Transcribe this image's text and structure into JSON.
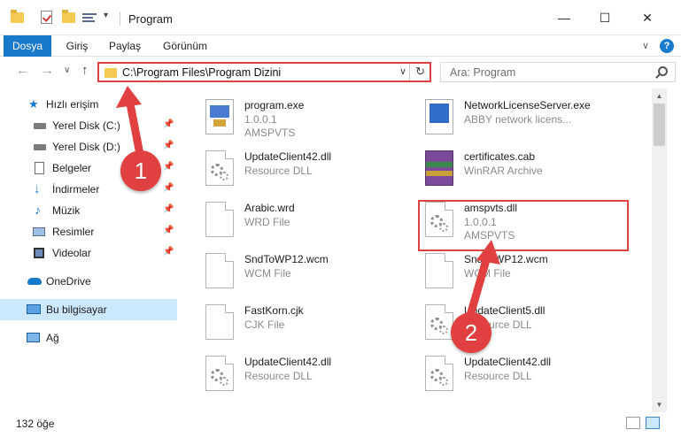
{
  "window": {
    "title": "Program",
    "minimize": "—",
    "maximize": "☐",
    "close": "✕"
  },
  "ribbon": {
    "tabs": [
      "Dosya",
      "Giriş",
      "Paylaş",
      "Görünüm"
    ],
    "expand": "∨",
    "help": "?"
  },
  "nav": {
    "back": "←",
    "forward": "→",
    "recent": "∨",
    "up": "↑"
  },
  "address": {
    "path": "C:\\Program Files\\Program Dizini",
    "dropdown": "∨",
    "refresh": "↻"
  },
  "search": {
    "placeholder": "Ara: Program"
  },
  "sidebar": {
    "items": [
      {
        "label": "Hızlı erişim",
        "icon": "star-icon",
        "pinned": false
      },
      {
        "label": "Yerel Disk (C:)",
        "icon": "drive-icon",
        "pinned": true
      },
      {
        "label": "Yerel Disk (D:)",
        "icon": "drive-icon",
        "pinned": true
      },
      {
        "label": "Belgeler",
        "icon": "documents-icon",
        "pinned": true
      },
      {
        "label": "İndirmeler",
        "icon": "download-icon",
        "pinned": true
      },
      {
        "label": "Müzik",
        "icon": "music-icon",
        "pinned": true
      },
      {
        "label": "Resimler",
        "icon": "pictures-icon",
        "pinned": true
      },
      {
        "label": "Videolar",
        "icon": "videos-icon",
        "pinned": true
      },
      {
        "label": "OneDrive",
        "icon": "cloud-icon",
        "pinned": false
      },
      {
        "label": "Bu bilgisayar",
        "icon": "computer-icon",
        "pinned": false,
        "selected": true
      },
      {
        "label": "Ağ",
        "icon": "network-icon",
        "pinned": false
      }
    ]
  },
  "files": [
    {
      "name": "program.exe",
      "line1": "1.0.0.1",
      "line2": "AMSPVTS",
      "icon": "exe-icon"
    },
    {
      "name": "NetworkLicenseServer.exe",
      "line1": "ABBY network licens...",
      "line2": "",
      "icon": "exe-icon"
    },
    {
      "name": "UpdateClient42.dll",
      "line1": "Resource DLL",
      "line2": "",
      "icon": "dll-icon"
    },
    {
      "name": "certificates.cab",
      "line1": "WinRAR Archive",
      "line2": "",
      "icon": "archive-icon"
    },
    {
      "name": "Arabic.wrd",
      "line1": "WRD File",
      "line2": "",
      "icon": "file-icon"
    },
    {
      "name": "amspvts.dll",
      "line1": "1.0.0.1",
      "line2": "AMSPVTS",
      "icon": "dll-icon",
      "highlighted": true
    },
    {
      "name": "SndToWP12.wcm",
      "line1": "WCM File",
      "line2": "",
      "icon": "file-icon"
    },
    {
      "name": "SndToWP12.wcm",
      "line1": "WCM File",
      "line2": "",
      "icon": "file-icon"
    },
    {
      "name": "FastKorn.cjk",
      "line1": "CJK File",
      "line2": "",
      "icon": "file-icon"
    },
    {
      "name": "UpdateClient5.dll",
      "line1": "Resource DLL",
      "line2": "",
      "icon": "dll-icon"
    },
    {
      "name": "UpdateClient42.dll",
      "line1": "Resource DLL",
      "line2": "",
      "icon": "dll-icon"
    },
    {
      "name": "UpdateClient42.dll",
      "line1": "Resource DLL",
      "line2": "",
      "icon": "dll-icon"
    }
  ],
  "status": {
    "count": "132 öğe"
  },
  "annotations": {
    "step1": "1",
    "step2": "2",
    "color": "#e0403f"
  },
  "colors": {
    "accent": "#1979ca",
    "selection": "#cce8ff",
    "folder": "#f4ca54"
  }
}
